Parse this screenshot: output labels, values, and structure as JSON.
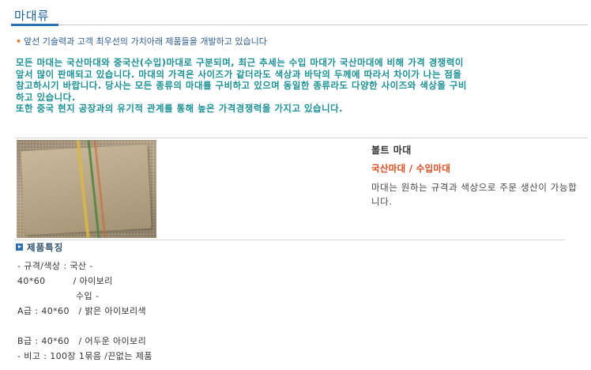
{
  "page": {
    "title": "마대류",
    "slogan": "앞선 기술력과 고객 최우선의 가치아래 제품들을 개발하고 있습니다"
  },
  "intro": {
    "lines": [
      "모든 마대는 국산마대와 중국산(수입)마대로 구분되며, 최근 추세는 수입 마대가 국산마대에 비해 가격 경쟁력이",
      "앞서 많이 판매되고 있습니다. 마대의 가격은 사이즈가 같더라도 색상과 바닥의 두께에 따라서 차이가 나는 점을",
      "참고하시기 바랍니다. 당사는 모든 종류의 마대를 구비하고 있으며 동일한 종류라도 다양한 사이즈와 색상을 구비",
      "하고 있습니다.",
      "또한 중국 현지 공장과의 유기적 관계를 통해 높은 가격경쟁력을 가지고 있습니다."
    ]
  },
  "product": {
    "name": "볼트 마대",
    "type": "국산마대 / 수입마대",
    "description": "마대는 원하는 규격과 색상으로 주문 생산이 가능합니다."
  },
  "features": {
    "heading": "제품특징",
    "lines": [
      "- 규격/색상 : 국산 -",
      "40*60         / 아이보리",
      "                   수입 -",
      "A급 : 40*60   / 밝은 아이보리색",
      "",
      "B급 : 40*60   / 어두운 아이보리",
      "- 비고 : 100장 1묶음 /끈없는 제품"
    ]
  },
  "colors": {
    "title": "#1a5fa0",
    "intro_text": "#1a8f94",
    "product_type": "#d84a1b",
    "accent_blue": "#2e6fb3"
  }
}
